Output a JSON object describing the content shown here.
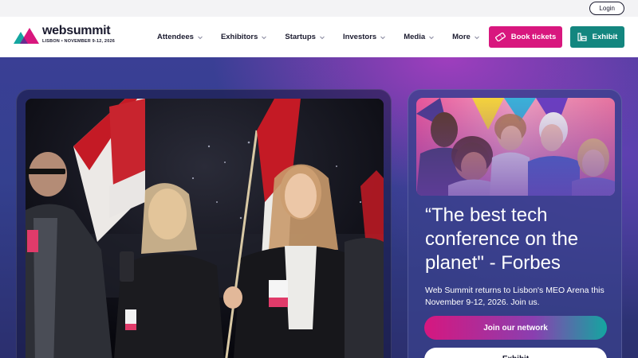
{
  "utility": {
    "login_label": "Login"
  },
  "brand": {
    "name": "websummit",
    "tagline": "LISBON • NOVEMBER 9-12, 2026",
    "colors": {
      "pink": "#d8177e",
      "teal": "#13867f",
      "navy": "#1b1b2f"
    }
  },
  "nav": {
    "items": [
      {
        "label": "Attendees",
        "icon": "chevron-down-icon"
      },
      {
        "label": "Exhibitors",
        "icon": "chevron-down-icon"
      },
      {
        "label": "Startups",
        "icon": "chevron-down-icon"
      },
      {
        "label": "Investors",
        "icon": "chevron-down-icon"
      },
      {
        "label": "Media",
        "icon": "chevron-down-icon"
      },
      {
        "label": "More",
        "icon": "chevron-down-icon"
      }
    ],
    "book_label": "Book tickets",
    "book_icon": "ticket-icon",
    "exhibit_label": "Exhibit",
    "exhibit_icon": "booth-icon"
  },
  "hero": {
    "quote": "“The best tech conference on the planet\" - Forbes",
    "description": "Web Summit returns to Lisbon's MEO Arena this November 9-12, 2026. Join us.",
    "join_label": "Join our network",
    "exhibit_label": "Exhibit"
  }
}
